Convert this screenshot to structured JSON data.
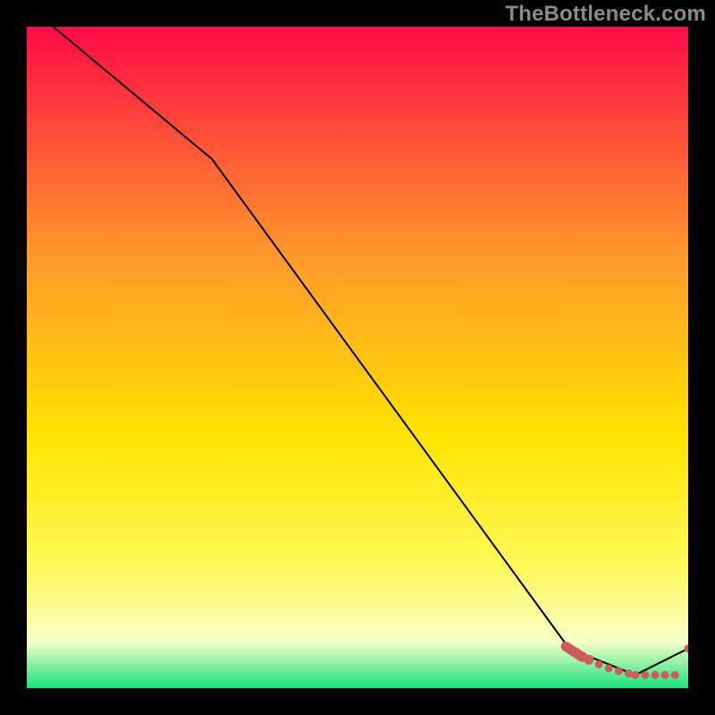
{
  "watermark": "TheBottleneck.com",
  "colors": {
    "gradient_top": "#ff0a46",
    "gradient_mid_upper": "#ff9a2a",
    "gradient_mid": "#ffe400",
    "gradient_mid_lower": "#fff95c",
    "gradient_pale": "#f6ffc8",
    "gradient_green": "#18e37a",
    "line": "#000000",
    "dots": "#cd5c5c",
    "background": "#000000"
  },
  "chart_data": {
    "type": "line",
    "title": "",
    "xlabel": "",
    "ylabel": "",
    "xlim": [
      0,
      100
    ],
    "ylim": [
      0,
      100
    ],
    "series": [
      {
        "name": "curve",
        "x": [
          4,
          28,
          82,
          92,
          100
        ],
        "y": [
          100,
          80,
          6,
          2,
          6
        ]
      }
    ],
    "dots": {
      "name": "highlight",
      "x": [
        82,
        83,
        84,
        85,
        86.5,
        88,
        89.5,
        91,
        92,
        93.5,
        95,
        96.5,
        98,
        100
      ],
      "y": [
        6,
        5.4,
        4.8,
        4.3,
        3.6,
        3.0,
        2.6,
        2.2,
        2.0,
        2.0,
        2.0,
        2.0,
        2.0,
        6
      ]
    }
  }
}
